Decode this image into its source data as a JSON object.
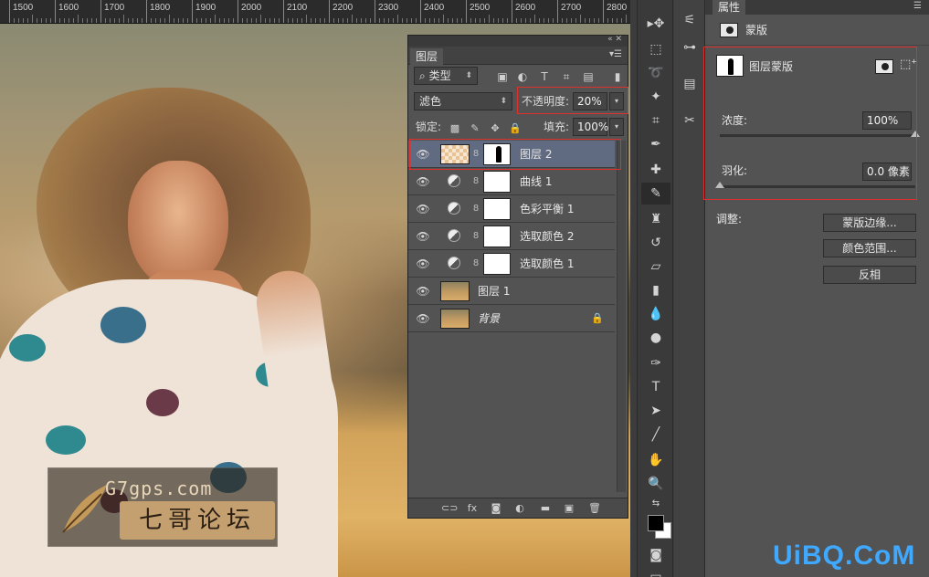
{
  "ruler": {
    "ticks": [
      "1500",
      "1600",
      "1700",
      "1800",
      "1900",
      "2000",
      "2100",
      "2200",
      "2300",
      "2400",
      "2500",
      "2600",
      "2700",
      "2800"
    ]
  },
  "watermark": {
    "url": "G7gps.com",
    "text": "七哥论坛"
  },
  "layers_panel": {
    "tab": "图层",
    "filter_kind": "类型",
    "blend_mode": "滤色",
    "opacity_label": "不透明度:",
    "opacity_value": "20%",
    "lock_label": "锁定:",
    "fill_label": "填充:",
    "fill_value": "100%",
    "layers": [
      {
        "name": "图层 2",
        "selected": true
      },
      {
        "name": "曲线 1"
      },
      {
        "name": "色彩平衡 1"
      },
      {
        "name": "选取颜色 2"
      },
      {
        "name": "选取颜色 1"
      },
      {
        "name": "图层 1"
      },
      {
        "name": "背景"
      }
    ],
    "bottom_icons": [
      "link-icon",
      "fx-icon",
      "mask-icon",
      "adjustment-icon",
      "folder-icon",
      "new-layer-icon",
      "trash-icon"
    ]
  },
  "properties_panel": {
    "tab": "属性",
    "section": "蒙版",
    "mask_type": "图层蒙版",
    "density_label": "浓度:",
    "density_value": "100%",
    "density_fraction": 1.0,
    "feather_label": "羽化:",
    "feather_value": "0.0 像素",
    "feather_fraction": 0.0,
    "adjust_label": "调整:",
    "buttons": [
      "蒙版边缘...",
      "颜色范围...",
      "反相"
    ]
  },
  "brand": "UiBQ.CoM",
  "colors": {
    "highlight_red": "#e0302c",
    "selected_layer": "#606a80",
    "brand_blue": "#3fa8ff"
  }
}
